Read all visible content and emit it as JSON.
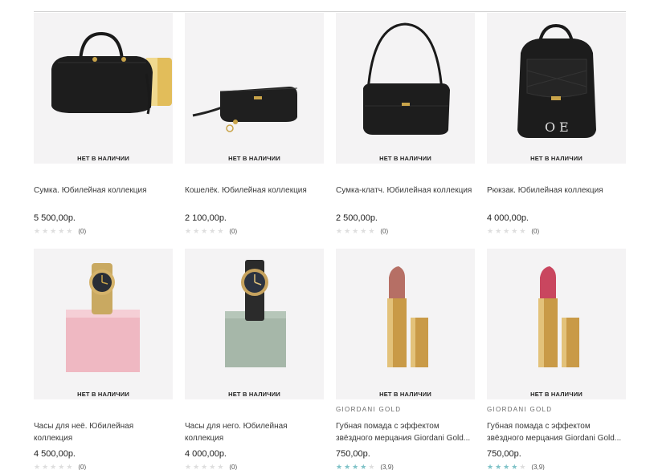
{
  "products": [
    {
      "title": "Сумка. Юбилейная коллекция",
      "price": "5 500,00р.",
      "stock": "НЕТ В НАЛИЧИИ",
      "brand": "",
      "rating": 0,
      "count": "(0)",
      "image_icon": "handbag-icon"
    },
    {
      "title": "Кошелёк. Юбилейная коллекция",
      "price": "2 100,00р.",
      "stock": "НЕТ В НАЛИЧИИ",
      "brand": "",
      "rating": 0,
      "count": "(0)",
      "image_icon": "wallet-icon"
    },
    {
      "title": "Сумка-клатч. Юбилейная коллекция",
      "price": "2 500,00р.",
      "stock": "НЕТ В НАЛИЧИИ",
      "brand": "",
      "rating": 0,
      "count": "(0)",
      "image_icon": "clutch-icon"
    },
    {
      "title": "Рюкзак. Юбилейная коллекция",
      "price": "4 000,00р.",
      "stock": "НЕТ В НАЛИЧИИ",
      "brand": "",
      "rating": 0,
      "count": "(0)",
      "image_icon": "backpack-icon"
    },
    {
      "title": "Часы для неё. Юбилейная коллекция",
      "price": "4 500,00р.",
      "stock": "НЕТ В НАЛИЧИИ",
      "brand": "",
      "rating": 0,
      "count": "(0)",
      "image_icon": "watch-icon"
    },
    {
      "title": "Часы для него. Юбилейная коллекция",
      "price": "4 000,00р.",
      "stock": "НЕТ В НАЛИЧИИ",
      "brand": "",
      "rating": 0,
      "count": "(0)",
      "image_icon": "watch-icon"
    },
    {
      "title": "Губная помада с эффектом звёздного мерцания Giordani Gold...",
      "price": "750,00р.",
      "stock": "НЕТ В НАЛИЧИИ",
      "brand": "GIORDANI GOLD",
      "rating": 3.9,
      "count": "(3,9)",
      "image_icon": "lipstick-icon"
    },
    {
      "title": "Губная помада с эффектом звёздного мерцания Giordani Gold...",
      "price": "750,00р.",
      "stock": "НЕТ В НАЛИЧИИ",
      "brand": "GIORDANI GOLD",
      "rating": 3.9,
      "count": "(3,9)",
      "image_icon": "lipstick-icon"
    }
  ],
  "colors": {
    "star_active": "#80c3c8",
    "star_inactive": "#dedede",
    "image_bg": "#f4f3f4"
  }
}
